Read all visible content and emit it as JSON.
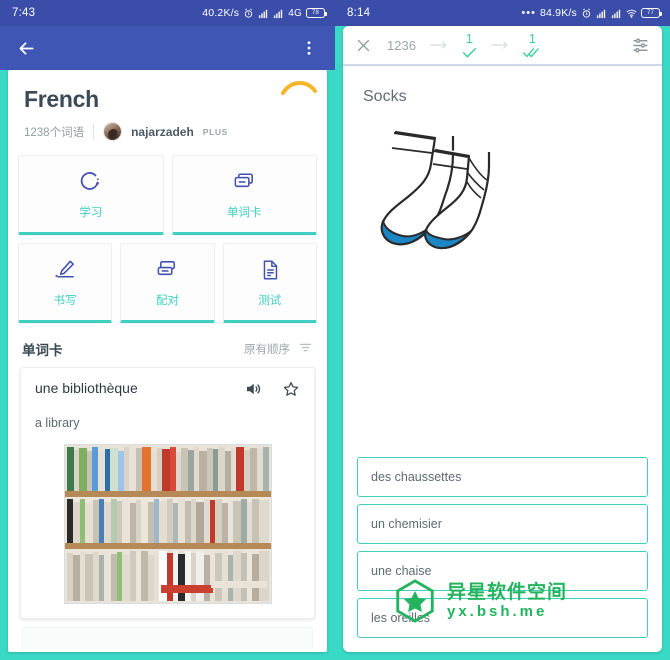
{
  "theme": {
    "teal": "#3ad9c6",
    "header_blue": "#3f56b5",
    "status_blue": "#3a4da8",
    "accent_teal": "#3ecfc0",
    "green": "#3ecfa0",
    "text_dark": "#3b4a54",
    "text_muted": "#9aa6ad",
    "watermark_green": "#24b35e"
  },
  "left_phone": {
    "status_bar": {
      "time": "7:43",
      "network_speed": "40.2K/s",
      "alarm_icon": "alarm-icon",
      "signal_icon": "signal-bars-icon",
      "signal2_icon": "signal-bars-2-icon",
      "network_type": "4G",
      "battery_level": "78"
    },
    "appbar": {
      "back_icon": "back-arrow-icon",
      "overflow_icon": "more-vertical-icon"
    },
    "set_header": {
      "title": "French",
      "term_count": "1238个词语",
      "author": "najarzadeh",
      "plus_badge": "PLUS",
      "avatar_name": "avatar",
      "arc_decoration": "yellow-arc-decoration"
    },
    "modes": [
      {
        "label": "学习",
        "icon": "study-circle-icon",
        "name": "mode-card-study"
      },
      {
        "label": "单词卡",
        "icon": "flashcards-icon",
        "name": "mode-card-flashcards"
      },
      {
        "label": "书写",
        "icon": "write-pen-icon",
        "name": "mode-card-write"
      },
      {
        "label": "配对",
        "icon": "match-cards-icon",
        "name": "mode-card-match"
      },
      {
        "label": "测试",
        "icon": "test-document-icon",
        "name": "mode-card-test"
      }
    ],
    "section": {
      "title": "单词卡",
      "sort_label": "原有顺序",
      "sort_icon": "filter-sort-icon"
    },
    "flashcard": {
      "term": "une bibliothèque",
      "definition": "a library",
      "audio_icon": "speaker-volume-icon",
      "star_icon": "star-outline-icon",
      "image_alt": "bookshelf-photo"
    }
  },
  "right_phone": {
    "status_bar": {
      "time": "8:14",
      "dots_icon": "more-horizontal-icon",
      "network_speed": "84.9K/s",
      "alarm_icon": "alarm-icon",
      "signal_icon": "signal-bars-icon",
      "signal2_icon": "signal-bars-2-icon",
      "wifi_icon": "wifi-icon",
      "battery_level": "77"
    },
    "toolbar": {
      "close_icon": "close-x-icon",
      "remaining_count": "1236",
      "arrow1_icon": "arrow-right-icon",
      "learning_count": "1",
      "learning_icon": "single-check-icon",
      "arrow2_icon": "arrow-right-icon",
      "mastered_count": "1",
      "mastered_icon": "double-check-icon",
      "settings_icon": "tune-sliders-icon"
    },
    "question": {
      "prompt": "Socks",
      "image_alt": "socks-illustration",
      "options": [
        "des chaussettes",
        "un chemisier",
        "une chaise",
        "les oreilles"
      ]
    }
  },
  "watermark": {
    "logo_icon": "hexagon-star-logo-icon",
    "cn_text": "异星软件空间",
    "url_text": "yx.bsh.me"
  }
}
